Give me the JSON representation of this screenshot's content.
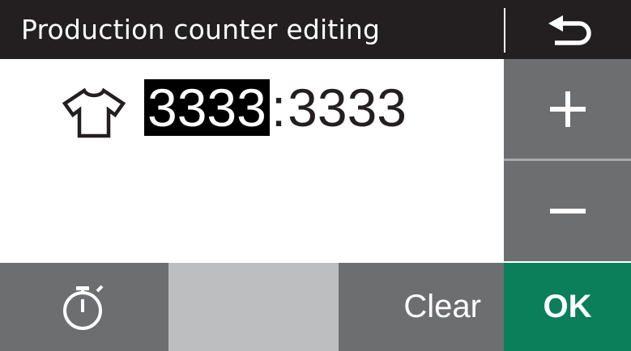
{
  "header": {
    "title": "Production counter editing",
    "back_icon": "return-arrow-icon"
  },
  "counter": {
    "icon": "t-shirt-icon",
    "current": "3333",
    "separator": ":",
    "target": "3333"
  },
  "controls": {
    "increase_icon": "plus-icon",
    "decrease_icon": "minus-icon"
  },
  "footer": {
    "timer_icon": "stopwatch-icon",
    "clear_label": "Clear",
    "ok_label": "OK"
  },
  "colors": {
    "header_bg": "#231f20",
    "button_gray": "#6d6e70",
    "button_light": "#bcbec0",
    "ok_green": "#0a7f5a"
  }
}
